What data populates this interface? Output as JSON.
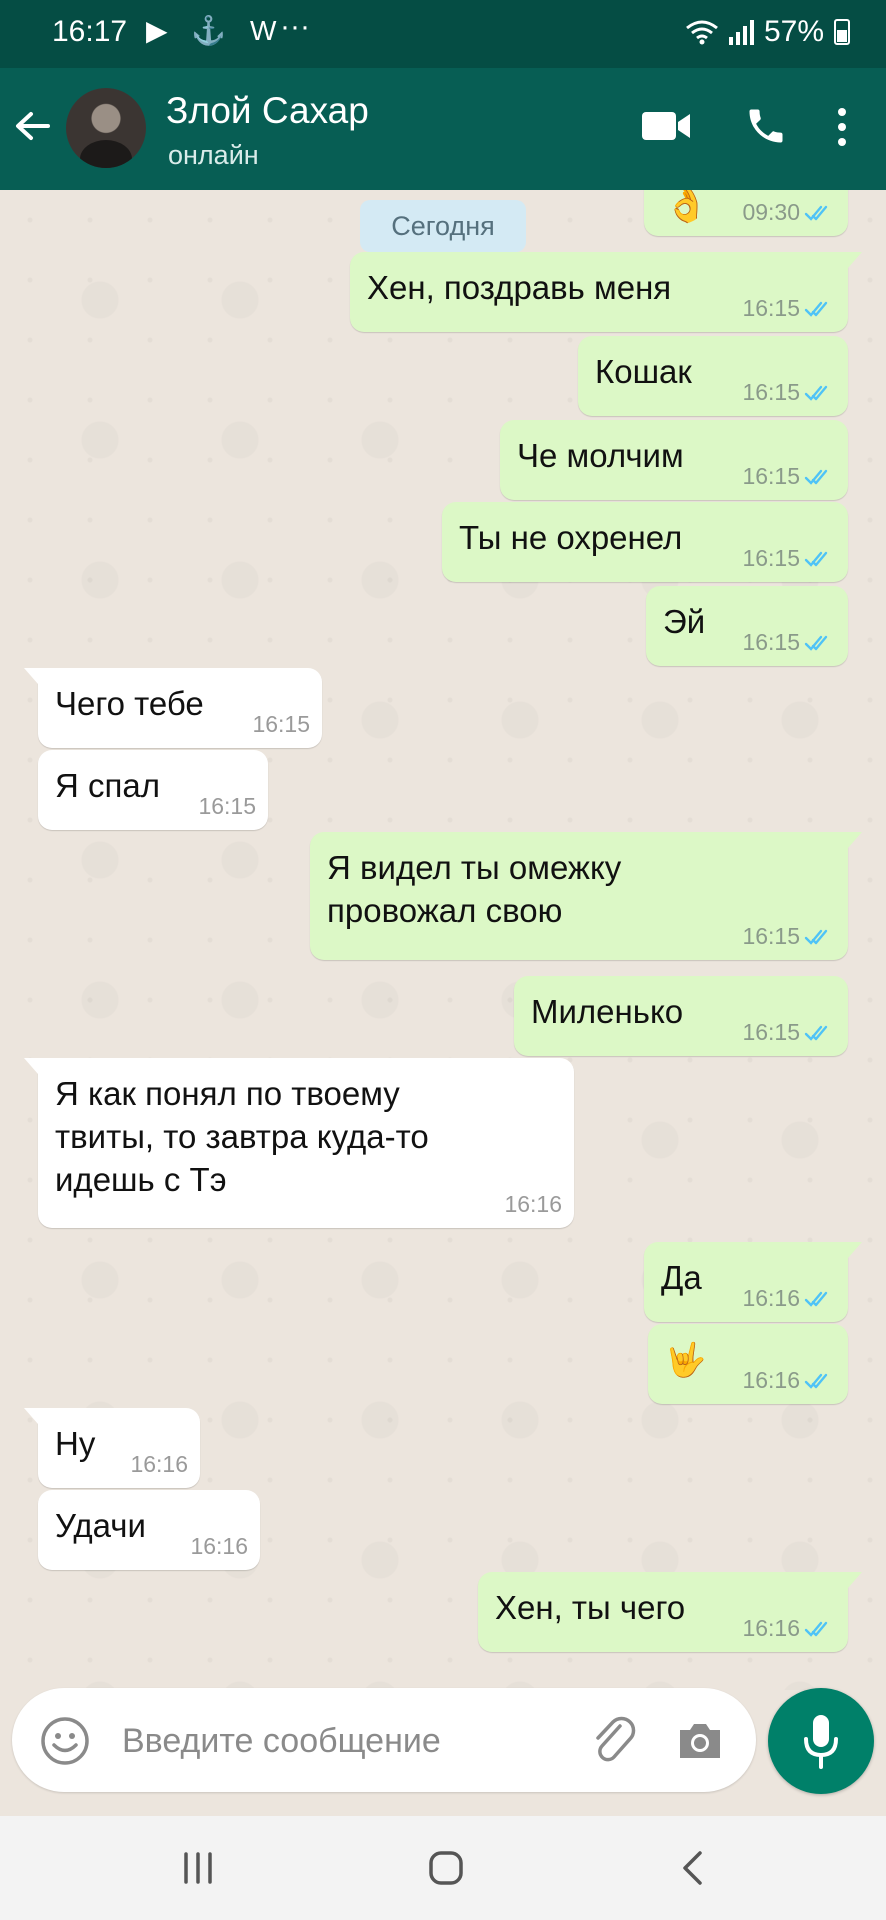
{
  "status_bar": {
    "time": "16:17",
    "icons": "▶ ⚓ W",
    "more": "···",
    "battery": "57%"
  },
  "header": {
    "contact_name": "Злой Сахар",
    "contact_status": "онлайн"
  },
  "chat": {
    "partial_top_time": "09:30",
    "partial_top_emoji": "👌",
    "date_separator": "Сегодня",
    "messages": [
      {
        "dir": "out",
        "text": "Хен, поздравь меня",
        "time": "16:15"
      },
      {
        "dir": "out",
        "text": "Кошак",
        "time": "16:15"
      },
      {
        "dir": "out",
        "text": "Че молчим",
        "time": "16:15"
      },
      {
        "dir": "out",
        "text": "Ты не охренел",
        "time": "16:15"
      },
      {
        "dir": "out",
        "text": "Эй",
        "time": "16:15"
      },
      {
        "dir": "in",
        "text": "Чего тебе",
        "time": "16:15"
      },
      {
        "dir": "in",
        "text": "Я спал",
        "time": "16:15"
      },
      {
        "dir": "out",
        "text": "Я видел ты омежку\nпровожал свою",
        "time": "16:15"
      },
      {
        "dir": "out",
        "text": "Миленько",
        "time": "16:15"
      },
      {
        "dir": "in",
        "text": "Я как понял по твоему\nтвиты, то завтра куда-то\nидешь с Тэ",
        "time": "16:16"
      },
      {
        "dir": "out",
        "text": "Да",
        "time": "16:16"
      },
      {
        "dir": "out",
        "text": "🤟",
        "time": "16:16"
      },
      {
        "dir": "in",
        "text": "Ну",
        "time": "16:16"
      },
      {
        "dir": "in",
        "text": "Удачи",
        "time": "16:16"
      },
      {
        "dir": "out",
        "text": "Хен, ты чего",
        "time": "16:16"
      }
    ]
  },
  "composer": {
    "placeholder": "Введите сообщение",
    "value": ""
  },
  "colors": {
    "header": "#075e54",
    "status_bar": "#054d44",
    "outgoing": "#dcf8c6",
    "incoming": "#ffffff",
    "read_ticks": "#4fc3f7",
    "mic_button": "#008069"
  }
}
